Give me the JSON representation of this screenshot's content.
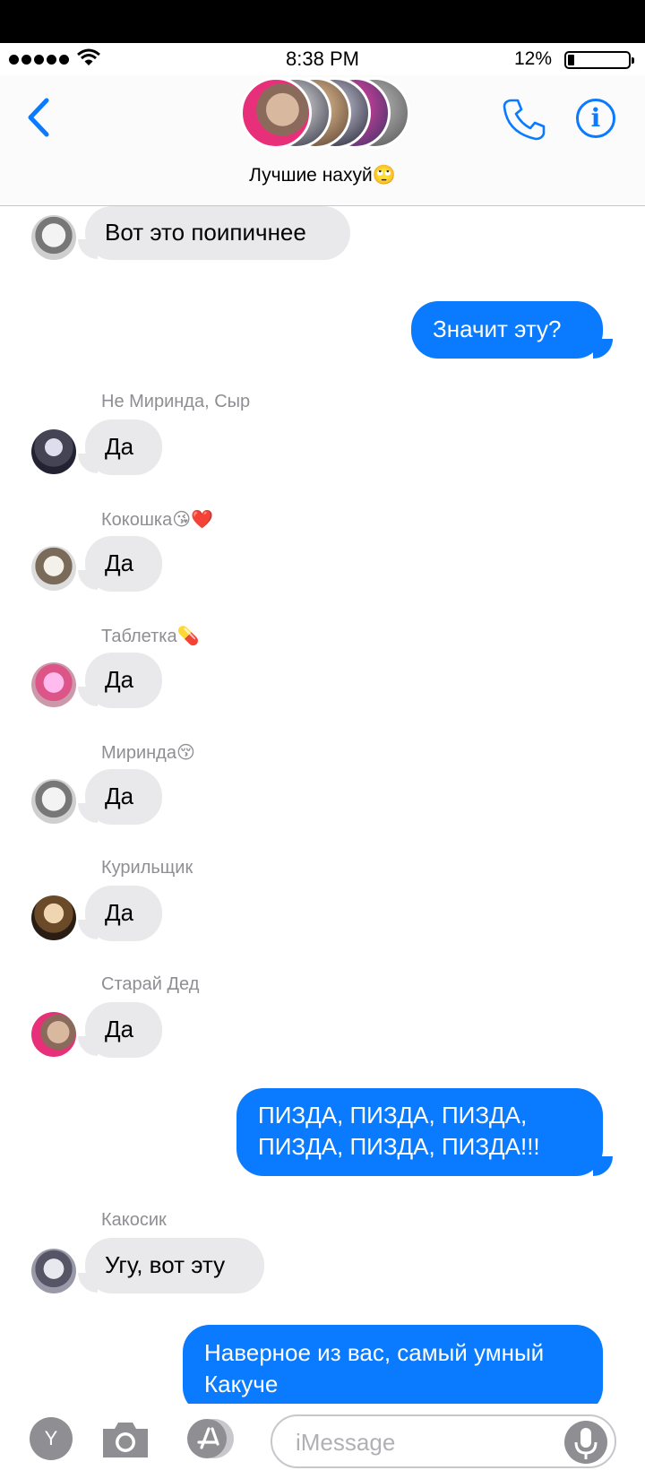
{
  "status_bar": {
    "time": "8:38 PM",
    "battery": "12%"
  },
  "header": {
    "title": "Лучшие нахуй🙄"
  },
  "colors": {
    "accent": "#0a7aff",
    "incoming": "#e9e9eb",
    "sender_label": "#8e8e93"
  },
  "messages": [
    {
      "text": "Вот это поипичнее"
    },
    {
      "text": "Значит эту?"
    },
    {
      "sender": "Не Миринда, Сыр",
      "text": "Да"
    },
    {
      "sender": "Кокошка😘❤️",
      "text": "Да"
    },
    {
      "sender": "Таблетка💊",
      "text": "Да"
    },
    {
      "sender": "Миринда😚",
      "text": "Да"
    },
    {
      "sender": "Курильщик",
      "text": "Да"
    },
    {
      "sender": "Старай Дед",
      "text": "Да"
    },
    {
      "line1": "ПИЗДА, ПИЗДА, ПИЗДА,",
      "line2": "ПИЗДА, ПИЗДА, ПИЗДА!!!"
    },
    {
      "sender": "Какосик",
      "text": "Угу, вот эту"
    },
    {
      "line1": "Наверное из вас, самый умный",
      "line2": "Какуче"
    }
  ],
  "input": {
    "placeholder": "iMessage",
    "apps_label": "Y"
  }
}
